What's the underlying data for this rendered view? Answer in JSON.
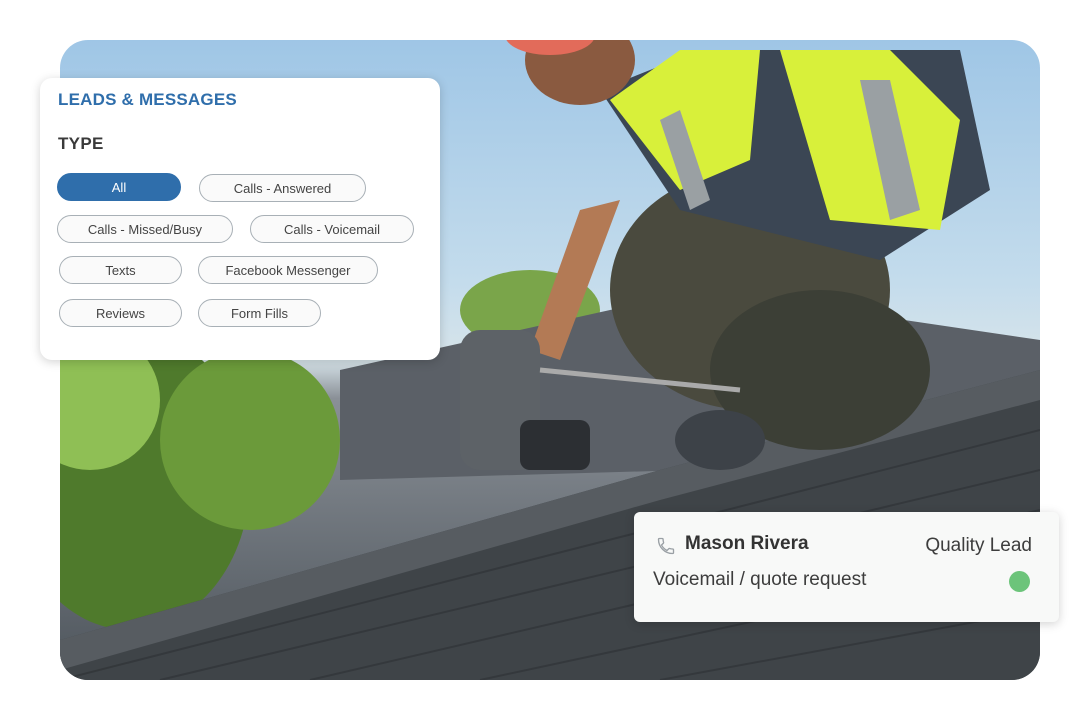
{
  "filter_panel": {
    "title": "LEADS & MESSAGES",
    "subtitle": "TYPE",
    "chips": [
      {
        "label": "All",
        "active": true
      },
      {
        "label": "Calls - Answered",
        "active": false
      },
      {
        "label": "Calls - Missed/Busy",
        "active": false
      },
      {
        "label": "Calls - Voicemail",
        "active": false
      },
      {
        "label": "Texts",
        "active": false
      },
      {
        "label": "Facebook Messenger",
        "active": false
      },
      {
        "label": "Reviews",
        "active": false
      },
      {
        "label": "Form Fills",
        "active": false
      }
    ]
  },
  "lead_card": {
    "icon": "phone-icon",
    "name": "Mason Rivera",
    "quality": "Quality Lead",
    "type": "Voicemail / quote request",
    "status_color": "#6cc47a"
  },
  "colors": {
    "accent": "#2f6eab"
  }
}
